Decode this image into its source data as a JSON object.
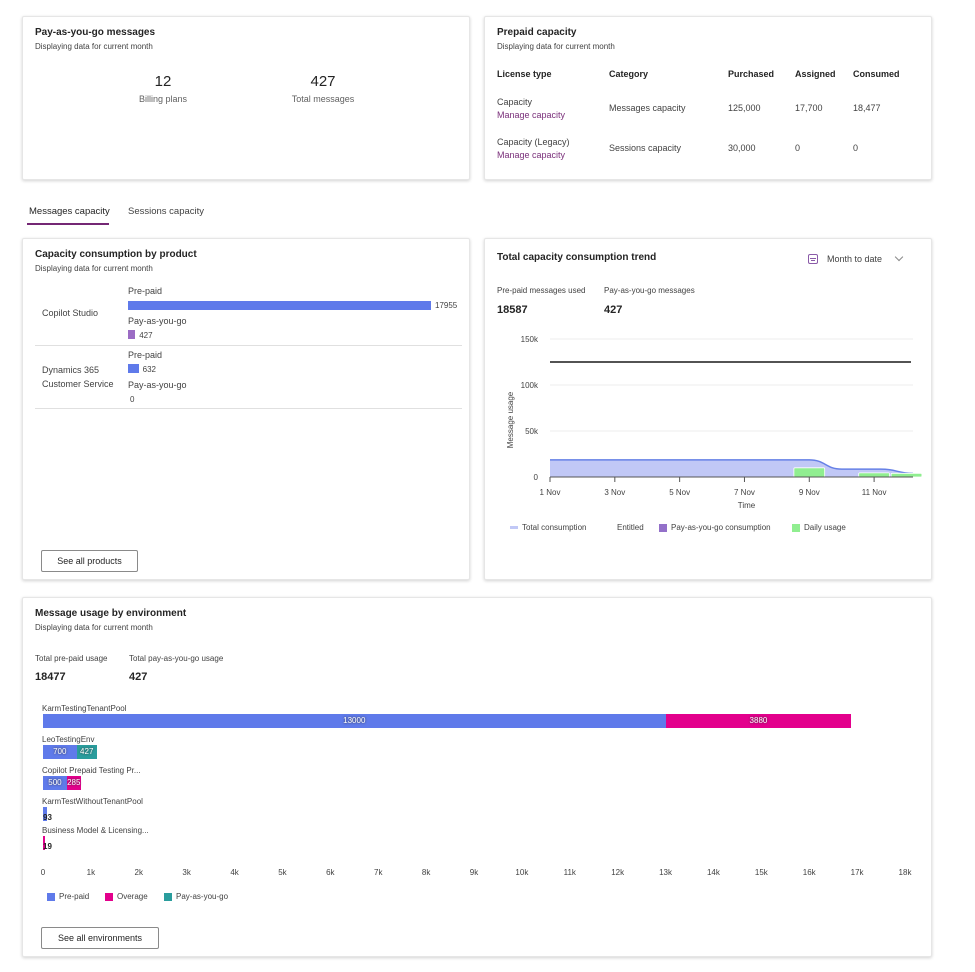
{
  "payg_card": {
    "title": "Pay-as-you-go messages",
    "subtitle": "Displaying data for current month",
    "stats": [
      {
        "value": "12",
        "label": "Billing plans"
      },
      {
        "value": "427",
        "label": "Total messages"
      }
    ]
  },
  "prepaid_card": {
    "title": "Prepaid capacity",
    "subtitle": "Displaying data for current month",
    "columns": [
      "License type",
      "Category",
      "Purchased",
      "Assigned",
      "Consumed"
    ],
    "rows": [
      {
        "license_type": "Capacity",
        "link": "Manage capacity",
        "category": "Messages capacity",
        "purchased": "125,000",
        "assigned": "17,700",
        "consumed": "18,477"
      },
      {
        "license_type": "Capacity (Legacy)",
        "link": "Manage capacity",
        "category": "Sessions capacity",
        "purchased": "30,000",
        "assigned": "0",
        "consumed": "0"
      }
    ]
  },
  "tabs": [
    {
      "label": "Messages capacity",
      "active": true
    },
    {
      "label": "Sessions capacity",
      "active": false
    }
  ],
  "product_card": {
    "title": "Capacity consumption by product",
    "subtitle": "Displaying data for current month",
    "prepaid_label": "Pre-paid",
    "payg_label": "Pay-as-you-go",
    "products": [
      {
        "name_lines": [
          "Copilot Studio"
        ],
        "prepaid": 17955,
        "payg": 427
      },
      {
        "name_lines": [
          "Dynamics 365",
          "Customer Service"
        ],
        "prepaid": 632,
        "payg": 0
      }
    ],
    "max_value": 17955,
    "colors": {
      "prepaid": "#5f7aea",
      "payg": "#9b6cc4"
    },
    "button": "See all products"
  },
  "trend_card": {
    "title": "Total capacity consumption trend",
    "date_filter": "Month to date",
    "kpis": [
      {
        "label": "Pre-paid messages used",
        "value": "18587"
      },
      {
        "label": "Pay-as-you-go messages",
        "value": "427"
      }
    ],
    "chart_data": {
      "type": "area",
      "title": "Total capacity consumption trend",
      "xlabel": "Time",
      "ylabel": "Message usage",
      "ylim": [
        0,
        150000
      ],
      "y_ticks": [
        {
          "v": 0,
          "label": "0"
        },
        {
          "v": 50000,
          "label": "50k"
        },
        {
          "v": 100000,
          "label": "100k"
        },
        {
          "v": 150000,
          "label": "150k"
        }
      ],
      "x_ticks": [
        {
          "d": 1,
          "label": "1 Nov"
        },
        {
          "d": 3,
          "label": "3 Nov"
        },
        {
          "d": 5,
          "label": "5 Nov"
        },
        {
          "d": 7,
          "label": "7 Nov"
        },
        {
          "d": 9,
          "label": "9 Nov"
        },
        {
          "d": 11,
          "label": "11 Nov"
        }
      ],
      "xlim": [
        1,
        12.2
      ],
      "entitled": 125000,
      "total_consumption": [
        {
          "d": 1,
          "v": 18600
        },
        {
          "d": 9,
          "v": 18600
        },
        {
          "d": 10,
          "v": 8600
        },
        {
          "d": 11.2,
          "v": 8600
        },
        {
          "d": 12.2,
          "v": 4000
        }
      ],
      "daily_usage": [
        {
          "d": 9,
          "v": 10000
        },
        {
          "d": 11,
          "v": 4500
        },
        {
          "d": 12,
          "v": 4000
        }
      ],
      "legend": [
        "Total consumption",
        "Entitled",
        "Pay-as-you-go consumption",
        "Daily usage"
      ],
      "grid": true,
      "legend_position": "bottom"
    },
    "colors": {
      "area": "#c1c8f6",
      "line": "#6680e6",
      "entitled": "#1a1a1a",
      "payg": "#9370c9",
      "daily": "#90ee90"
    }
  },
  "env_card": {
    "title": "Message usage by environment",
    "subtitle": "Displaying data for current month",
    "kpis": [
      {
        "label": "Total pre-paid usage",
        "value": "18477"
      },
      {
        "label": "Total pay-as-you-go usage",
        "value": "427"
      }
    ],
    "chart_data": {
      "type": "bar",
      "orientation": "horizontal-stacked",
      "categories": [
        "KarmTestingTenantPool",
        "LeoTestingEnv",
        "Copilot Prepaid Testing Pr...",
        "KarmTestWithoutTenantPool",
        "Business Model & Licensing..."
      ],
      "series": [
        {
          "name": "Pre-paid",
          "values": [
            13000,
            700,
            500,
            93,
            0
          ]
        },
        {
          "name": "Overage",
          "values": [
            3880,
            0,
            285,
            0,
            19
          ]
        },
        {
          "name": "Pay-as-you-go",
          "values": [
            0,
            427,
            0,
            0,
            0
          ]
        }
      ],
      "xlim": [
        0,
        18000
      ],
      "x_ticks": [
        "0",
        "1k",
        "2k",
        "3k",
        "4k",
        "5k",
        "6k",
        "7k",
        "8k",
        "9k",
        "10k",
        "11k",
        "12k",
        "13k",
        "14k",
        "15k",
        "16k",
        "17k",
        "18k"
      ],
      "legend_position": "bottom-left"
    },
    "colors": {
      "Pre-paid": "#5f7aea",
      "Overage": "#e3008c",
      "Pay-as-you-go": "#2a9d9d"
    },
    "button": "See all environments"
  }
}
